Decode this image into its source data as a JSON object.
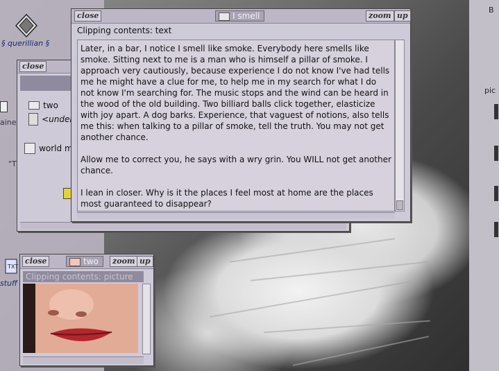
{
  "desktop": {
    "icons": [
      {
        "name": "querillian",
        "label": "§ querillian §"
      },
      {
        "name": "stuff",
        "label": "stuff"
      }
    ],
    "right_strip": {
      "top_label": "B",
      "mid_label": "pic"
    },
    "left_fragments": [
      "aine",
      "\"T"
    ]
  },
  "windows": {
    "text_clipping": {
      "title": "I smell",
      "close": "close",
      "zoom": "zoom",
      "up": "up",
      "header": "Clipping contents: text",
      "paragraphs": [
        "Later, in a bar, I notice I smell like smoke. Everybody here smells like smoke. Sitting next to me is a man who is himself a pillar of smoke. I approach very cautiously, because experience I do not know I've had tells me he might have a clue for me, to help me in my search for what I do not know I'm searching for. The music stops and the wind can be heard in the wood of the old building. Two billiard balls click together, elasticize with joy apart. A dog barks. Experience, that vaguest of notions, also tells me this: when talking to a pillar of smoke, tell the truth. You may not get another chance.",
        "Allow me to correct you, he says with a wry grin. You WILL not get another chance.",
        "I lean in closer. Why is it the places I feel most at home are the places most guaranteed to disappear?"
      ]
    },
    "folder": {
      "close": "close",
      "items": [
        {
          "label": "two"
        },
        {
          "label": "<under"
        },
        {
          "label": "world m"
        }
      ]
    },
    "picture_clipping": {
      "title": "two",
      "close": "close",
      "zoom": "zoom",
      "up": "up",
      "header": "Clipping contents: picture"
    }
  },
  "colors": {
    "desktop": "#b6b0be",
    "window": "#cfcad8",
    "titlebar": "#bcb6c6",
    "label_blue": "#1b2a66"
  }
}
